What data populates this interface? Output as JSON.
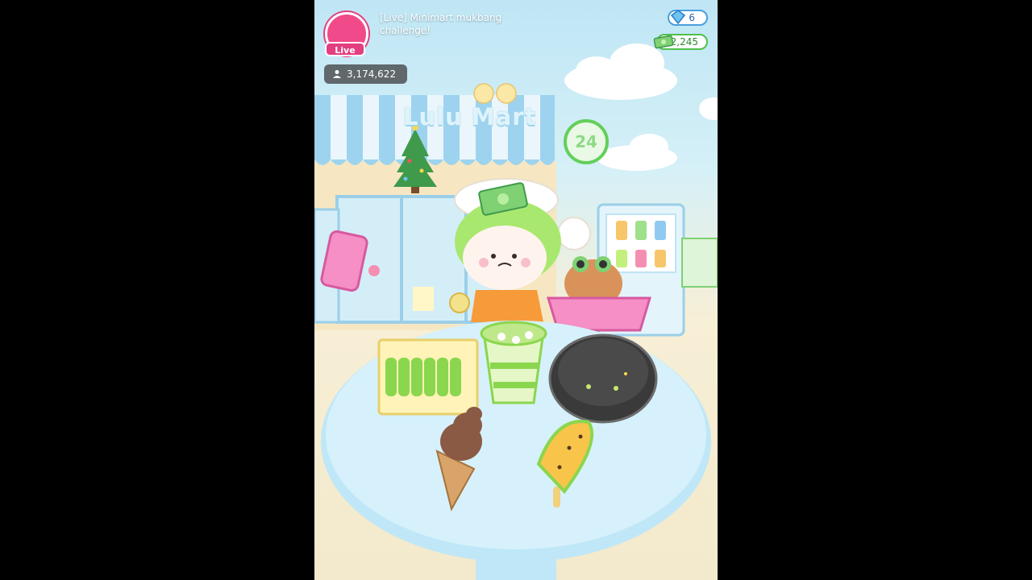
{
  "stream": {
    "live_label": "Live",
    "title": "[Live] Minimart mukbang challenge!",
    "viewer_count": "3,174,622"
  },
  "currency": {
    "gems": "6",
    "cash": "2,245"
  },
  "store": {
    "sign": "Lulu Mart",
    "hours_badge": "24"
  },
  "icons": [
    "user-icon",
    "gem-icon",
    "cash-icon",
    "christmas-tree-icon"
  ],
  "colors": {
    "live_pink": "#e23e80",
    "gem_blue": "#4a9fe0",
    "cash_green": "#4fbf4a",
    "table_blue": "#bfe7f7"
  }
}
